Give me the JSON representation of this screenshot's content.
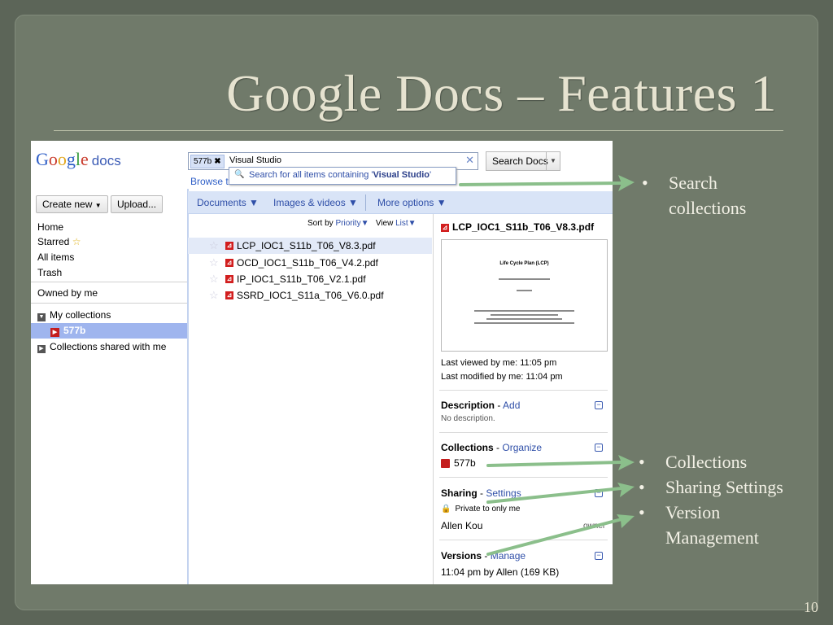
{
  "slide": {
    "title": "Google Docs – Features 1",
    "page_number": "10"
  },
  "app": {
    "logo_text": "Google",
    "logo_product": "docs",
    "search": {
      "chip_label": "577b",
      "query": "Visual Studio",
      "button_label": "Search Docs",
      "suggestion_prefix": "Search for all items containing '",
      "suggestion_query": "Visual Studio",
      "suggestion_suffix": "'"
    },
    "browse_label": "Browse t",
    "left_nav": {
      "create_new": "Create new",
      "upload": "Upload...",
      "items": [
        "Home",
        "Starred",
        "All items",
        "Trash"
      ],
      "owned_by_me": "Owned by me",
      "my_collections": "My collections",
      "collection_577b": "577b",
      "shared_collections": "Collections shared with me"
    },
    "toolbar": {
      "documents": "Documents ▼",
      "images_videos": "Images & videos ▼",
      "more_options": "More options ▼"
    },
    "sort": {
      "sort_by_label": "Sort by",
      "sort_by_value": "Priority▼",
      "view_label": "View",
      "view_value": "List▼"
    },
    "files": [
      "LCP_IOC1_S11b_T06_V8.3.pdf",
      "OCD_IOC1_S11b_T06_V4.2.pdf",
      "IP_IOC1_S11b_T06_V2.1.pdf",
      "SSRD_IOC1_S11a_T06_V6.0.pdf"
    ],
    "details": {
      "title": "LCP_IOC1_S11b_T06_V8.3.pdf",
      "thumb_title": "Life Cycle Plan (LCP)",
      "last_viewed": "Last viewed by me: 11:05 pm",
      "last_modified": "Last modified by me: 11:04 pm",
      "description_label": "Description",
      "description_action": "Add",
      "description_text": "No description.",
      "collections_label": "Collections",
      "collections_action": "Organize",
      "collection_name": "577b",
      "sharing_label": "Sharing",
      "sharing_action": "Settings",
      "sharing_status": "Private to only me",
      "owner_name": "Allen Kou",
      "owner_role": "owner",
      "versions_label": "Versions",
      "versions_action": "Manage",
      "version_text": "11:04 pm by Allen (169 KB)"
    }
  },
  "callouts": {
    "search_collections_line1": "Search",
    "search_collections_line2": "collections",
    "collections": "Collections",
    "sharing_settings": "Sharing Settings",
    "version_management_line1": "Version",
    "version_management_line2": "Management"
  },
  "colors": {
    "background": "#5c6558",
    "frame": "#707a6a",
    "arrow": "#8bbf8b",
    "title": "#e6e3d0"
  }
}
